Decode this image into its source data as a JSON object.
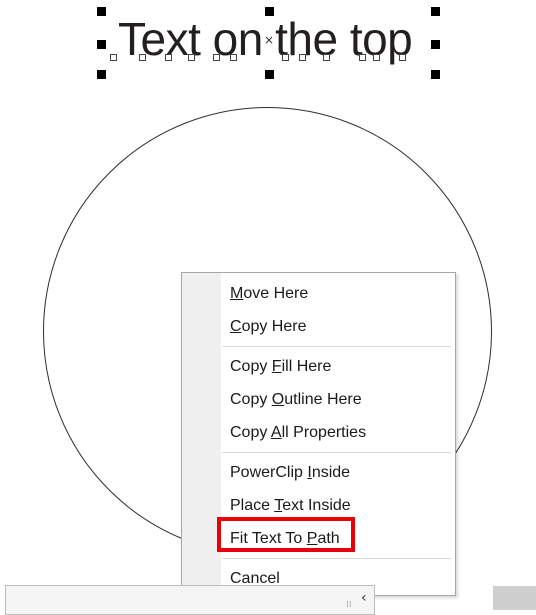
{
  "canvas": {
    "selected_text": "Text on the top",
    "center_marker": "×"
  },
  "context_menu": {
    "items": [
      {
        "pre": "",
        "key": "M",
        "post": "ove Here"
      },
      {
        "pre": "",
        "key": "C",
        "post": "opy Here"
      },
      {
        "pre": "Copy ",
        "key": "F",
        "post": "ill Here"
      },
      {
        "pre": "Copy ",
        "key": "O",
        "post": "utline Here"
      },
      {
        "pre": "Copy ",
        "key": "A",
        "post": "ll Properties"
      },
      {
        "pre": "PowerClip ",
        "key": "I",
        "post": "nside"
      },
      {
        "pre": "Place ",
        "key": "T",
        "post": "ext Inside"
      },
      {
        "pre": "Fit Text To ",
        "key": "P",
        "post": "ath"
      },
      {
        "pre": "Cancel",
        "key": "",
        "post": ""
      }
    ],
    "highlighted_item": "Fit Text To Path",
    "highlight_color": "#e8000b"
  },
  "bottom_bar": {
    "grip_glyph": "⁞⁞",
    "chevron_glyph": "‹"
  }
}
